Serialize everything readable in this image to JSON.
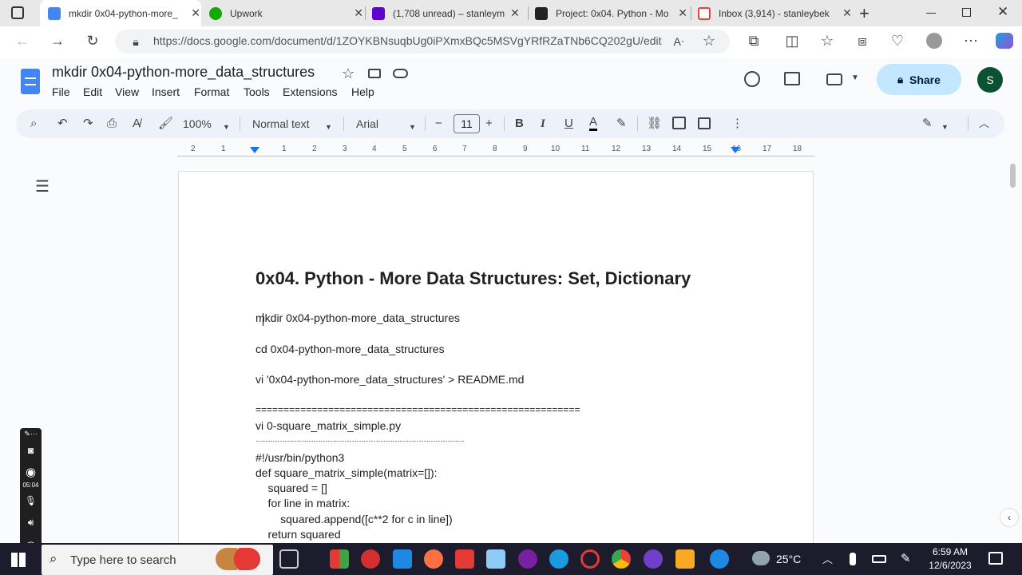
{
  "browser": {
    "tabs": [
      {
        "label": "mkdir 0x04-python-more_",
        "color": "#4285f4",
        "active": true
      },
      {
        "label": "Upwork",
        "color": "#14a800",
        "active": false
      },
      {
        "label": "(1,708 unread) – stanleym",
        "color": "#6001d2",
        "active": false
      },
      {
        "label": "Project: 0x04. Python - Mo",
        "color": "#222222",
        "active": false
      },
      {
        "label": "Inbox (3,914) - stanleybek",
        "color": "#ea4335",
        "active": false
      }
    ],
    "new_tab": "+",
    "url": "https://docs.google.com/document/d/1ZOYKBNsuqbUg0iPXmxBQc5MSVgYRfRZaTNb6CQ202gU/edit"
  },
  "docs": {
    "title": "mkdir 0x04-python-more_data_structures",
    "menu": [
      "File",
      "Edit",
      "View",
      "Insert",
      "Format",
      "Tools",
      "Extensions",
      "Help"
    ],
    "share_label": "Share",
    "avatar_letter": "S",
    "toolbar": {
      "zoom": "100%",
      "style": "Normal text",
      "font": "Arial",
      "font_size": "11"
    },
    "ruler_labels": [
      "2",
      "1",
      "1",
      "2",
      "3",
      "4",
      "5",
      "6",
      "7",
      "8",
      "9",
      "10",
      "11",
      "12",
      "13",
      "14",
      "15",
      "16",
      "17",
      "18"
    ]
  },
  "document": {
    "heading": "0x04. Python - More Data Structures: Set, Dictionary",
    "lines": [
      "mkdir 0x04-python-more_data_structures",
      "cd 0x04-python-more_data_structures",
      "vi '0x04-python-more_data_structures' > README.md",
      "==========================================================",
      "vi 0-square_matrix_simple.py",
      "……………………………………………………………………………",
      "#!/usr/bin/python3",
      "def square_matrix_simple(matrix=[]):",
      "    squared = []",
      "    for line in matrix:",
      "        squared.append([c**2 for c in line])",
      "    return squared"
    ]
  },
  "recorder": {
    "time": "05:04"
  },
  "taskbar": {
    "search_placeholder": "Type here to search",
    "temperature": "25°C",
    "time": "6:59 AM",
    "date": "12/6/2023"
  }
}
